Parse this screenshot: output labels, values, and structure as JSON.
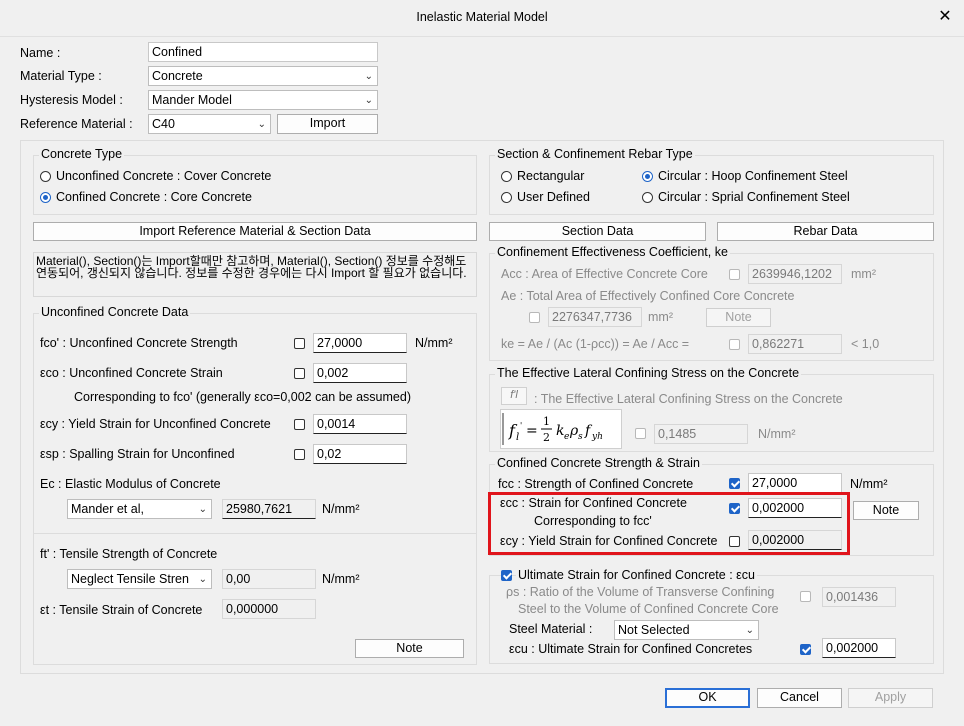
{
  "window": {
    "title": "Inelastic Material Model",
    "close": "✕"
  },
  "form": {
    "name_label": "Name :",
    "name_value": "Confined",
    "material_type_label": "Material Type :",
    "material_type_value": "Concrete",
    "hysteresis_label": "Hysteresis Model :",
    "hysteresis_value": "Mander Model",
    "ref_material_label": "Reference Material :",
    "ref_material_value": "C40",
    "import_label": "Import"
  },
  "concrete_type": {
    "title": "Concrete Type",
    "opt1": "Unconfined Concrete : Cover Concrete",
    "opt2": "Confined Concrete : Core Concrete"
  },
  "section_rebar": {
    "title": "Section & Confinement Rebar Type",
    "rect": "Rectangular",
    "user": "User Defined",
    "hoop": "Circular : Hoop Confinement Steel",
    "spiral": "Circular : Sprial Confinement Steel"
  },
  "buttons": {
    "import_ref": "Import Reference Material & Section Data",
    "section_data": "Section Data",
    "rebar_data": "Rebar Data",
    "note": "Note",
    "ok": "OK",
    "cancel": "Cancel",
    "apply": "Apply"
  },
  "memo": "Material(), Section()는 Import할때만 참고하며, Material(), Section() 정보를 수정해도 연동되어, 갱신되지 않습니다. 정보를 수정한 경우에는 다시 Import 할 필요가 없습니다.",
  "unconfined": {
    "title": "Unconfined Concrete Data",
    "fco_label": "fco' : Unconfined Concrete Strength",
    "fco_value": "27,0000",
    "fco_unit": "N/mm²",
    "eco_label": "εco : Unconfined Concrete Strain",
    "eco_value": "0,002",
    "eco_note": "Corresponding to fco' (generally εco=0,002 can be assumed)",
    "ecy_label": "εcy : Yield Strain for Unconfined Concrete",
    "ecy_value": "0,0014",
    "esp_label": "εsp : Spalling Strain for Unconfined",
    "esp_value": "0,02",
    "ec_label": "Ec : Elastic Modulus of Concrete",
    "ec_method": "Mander et al,",
    "ec_value": "25980,7621",
    "ec_unit": "N/mm²",
    "ft_label": "ft' : Tensile Strength of Concrete",
    "ft_method": "Neglect Tensile Stren",
    "ft_value": "0,00",
    "ft_unit": "N/mm²",
    "et_label": "εt : Tensile Strain of Concrete",
    "et_value": "0,000000"
  },
  "effectiveness": {
    "title": "Confinement Effectiveness Coefficient, ke",
    "acc_label": "Acc : Area of Effective Concrete Core",
    "acc_value": "2639946,1202",
    "acc_unit": "mm²",
    "ae_label": "Ae : Total Area of Effectively Confined Core Concrete",
    "ae_value": "2276347,7736",
    "ae_unit": "mm²",
    "ke_label": "ke = Ae / (Ac (1-ρcc)) = Ae / Acc =",
    "ke_value": "0,862271",
    "ke_limit": "< 1,0"
  },
  "lateral": {
    "title": "The Effective Lateral Confining Stress on the Concrete",
    "fl_symbol": "f'l",
    "fl_desc": ": The Effective Lateral Confining Stress on the Concrete",
    "fl_value": "0,1485",
    "fl_unit": "N/mm²"
  },
  "confined": {
    "title": "Confined Concrete Strength & Strain",
    "fcc_label": "fcc : Strength of Confined Concrete",
    "fcc_value": "27,0000",
    "fcc_unit": "N/mm²",
    "ecc_label1": "εcc : Strain for Confined Concrete",
    "ecc_label2": "Corresponding to fcc'",
    "ecc_value": "0,002000",
    "ecy_label": "εcy : Yield Strain for Confined Concrete",
    "ecy_value": "0,002000"
  },
  "ultimate": {
    "title": "Ultimate Strain for Confined Concrete : εcu",
    "rho_label1": "ρs : Ratio of the Volume of Transverse Confining",
    "rho_label2": "Steel  to the Volume of Confined Concrete Core",
    "rho_value": "0,001436",
    "steel_label": "Steel Material :",
    "steel_value": "Not Selected",
    "ecu_label": "εcu : Ultimate Strain for Confined Concretes",
    "ecu_value": "0,002000"
  },
  "colors": {
    "accent": "#1e64c8",
    "highlight": "#e0141b"
  }
}
